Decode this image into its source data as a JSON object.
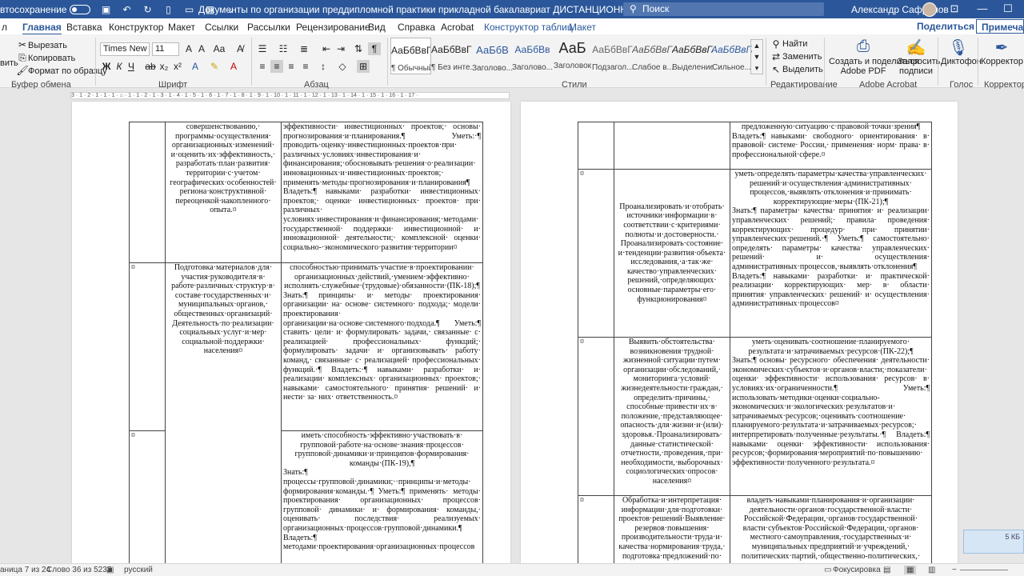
{
  "titlebar": {
    "autosave_label": "втосохранение",
    "doc_title": "Документы по организации преддипломной практики прикладной бакалавриат ДИСТАНЦИОННОЕ  -  режим совместимости  -  Word",
    "search_placeholder": "Поиск",
    "user_name": "Александр Сафронов",
    "minimize": "—",
    "restore": "☐"
  },
  "tabs": {
    "file": "л",
    "home": "Главная",
    "insert": "Вставка",
    "design": "Конструктор",
    "layout": "Макет",
    "references": "Ссылки",
    "mailings": "Рассылки",
    "review": "Рецензирование",
    "view": "Вид",
    "help": "Справка",
    "acrobat": "Acrobat",
    "table_design": "Конструктор таблиц",
    "table_layout": "Макет",
    "share": "Поделиться",
    "comments": "Примечан"
  },
  "ribbon": {
    "clipboard": {
      "cut": "Вырезать",
      "copy": "Копировать",
      "format_painter": "Формат по образцу",
      "paste": "вить",
      "label": "Буфер обмена"
    },
    "font": {
      "name": "Times New Rc",
      "size": "11",
      "label": "Шрифт"
    },
    "paragraph": {
      "label": "Абзац"
    },
    "styles": {
      "label": "Стили",
      "items": [
        {
          "preview": "АаБбВвГг,",
          "name": "¶ Обычный"
        },
        {
          "preview": "АаБбВвГг,",
          "name": "¶ Без инте..."
        },
        {
          "preview": "АаБбВ",
          "name": "Заголово..."
        },
        {
          "preview": "АаБбВв",
          "name": "Заголово..."
        },
        {
          "preview": "АаБ",
          "name": "Заголовок"
        },
        {
          "preview": "АаБбВвГ",
          "name": "Подзагол..."
        },
        {
          "preview": "АаБбВвГг",
          "name": "Слабое в..."
        },
        {
          "preview": "АаБбВвГг",
          "name": "Выделение"
        },
        {
          "preview": "АаБбВвГг",
          "name": "Сильное..."
        }
      ]
    },
    "editing": {
      "find": "Найти",
      "replace": "Заменить",
      "select": "Выделить",
      "label": "Редактирование"
    },
    "acrobat": {
      "create_share": "Создать и поделиться",
      "create_share2": "Adobe PDF",
      "request": "Запросить",
      "request2": "подписи",
      "label": "Adobe Acrobat"
    },
    "voice": {
      "dictate": "Диктофон",
      "label": "Голос"
    },
    "editor": {
      "editor": "Корректор",
      "label": "Корректор"
    }
  },
  "ruler_text": "3 · 1 · 2 · 1 · 1 · 1 · ⌂ · 1 · 1 · 2 · 1 · 3 · 1 · 4 · 1 · 5 · 1 · 6 · 1 · 7 · 1 · 8 · 1 · 9 · 1 · 10 · 1 · 11 · 1 · 12 · 1 · 13 · 1 · 14 · 1 · 15 · 1 · 16 · 1 · 17 ·",
  "left_page": {
    "rows": [
      {
        "c1": "",
        "c2": "совершенствованию,· программы·осуществления· организационных·изменений· и·оценить·их·эффективность,· разработать·план·развития· территории·с·учетом· географических·особенностей· региона·конструктивной· переоценкой·накопленного· опыта.¤",
        "c3": "эффективности· инвестиционных· проектов;· основы· прогнозирования·и·планирования.¶ Уметь:·¶ проводить·оценку·инвестиционных·проектов·при· различных·условиях·инвестирования·и· финансирования;·обосновывать·решения·о·реализации· инновационных·и·инвестиционных·проектов;· применять·методы·прогнозирования·и·планирования¶ Владеть:¶ навыками· разработки· инвестиционных· проектов;· оценки· инвестиционных· проектов· при· различных· условиях·инвестирования·и·финансирования;·методами· государственной· поддержки· инвестиционной· и· инновационной· деятельности;· комплексной· оценки· социально-·экономического·развития·территории¤"
      },
      {
        "c1": "¤",
        "c2": "Подготовка·материалов·для· участия·руководителя·в· работе·различных·структур·в· составе·государственных·и· муниципальных·органов,· общественных·организаций· Деятельность·по·реализации· социальных·услуг·и·мер· социальной·поддержки· населения¤",
        "c3_head": "способностью·принимать·участие·в·проектировании· организационных·действий,·умением·эффективно· исполнять·служебные·(трудовые)·обязанности·(ПК-18);¶",
        "c3": "Знать:¶ принципы· и· методы· проектирования· организации· на· основе· системного· подхода;· модели· проектирования· организации·на·основе·системного·подхода.¶ Уметь:¶ ставить· цели· и· формулировать· задачи,· связанные· с· реализацией· профессиональных· функций;· формулировать· задачи· и· организовывать· работу· команд,· связанные· с· реализацией· профессиональных· функций.·¶ Владеть:·¶ навыками· разработки· и· реализации· комплексных· организационных· проектов;· навыками· самостоятельного· принятия· решений· и· нести· за· них· ответственность.¤"
      },
      {
        "c1": "¤",
        "c2": "",
        "c3_head": "иметь·способность·эффективно·участвовать·в· групповой·работе·на·основе·знания·процессов· групповой·динамики·и·принципов·формирования· команды·(ПК-19),¶",
        "c3": "Знать:¶ процессы·групповой·динамики;··принципы·и·методы· формирования·команды.·¶ Уметь:¶ применять· методы· проектирования· организационных· процессов· групповой· динамики· и· формирования· команды,· оценивать· последствия· реализуемых· организационных·процессов·групповой·динамики.¶ Владеть:¶ методами·проектирования·организационных·процессов"
      }
    ]
  },
  "right_page": {
    "rows": [
      {
        "c1": "",
        "c2": "",
        "c3_head": "предложенную·ситуацию·с·правовой·точки·зрения¶",
        "c3": "Владеть:¶ навыками· свободного· ориентирования· в· правовой· системе· России,· применения· норм· права· в· профессиональной·сфере.¤"
      },
      {
        "c1": "¤",
        "c2": "Проанализировать·и·отобрать· источники·информации·в· соответствии·с·критериями· полноты·и·достоверности.· Проанализировать·состояние· и·тенденции·развития·объекта· исследования,·а·так·же· качество·управленческих· решений,·определяющих· основные·параметры·его· функционирования¤",
        "c3_head": "уметь·определять·параметры·качества·управленческих· решений·и·осуществления·административных· процессов,·выявлять·отклонения·и·принимать· корректирующие·меры·(ПК-21);¶",
        "c3": "Знать:¶ параметры· качества· принятия· и· реализации· управленческих· решений;· правила· проведения· корректирующих· процедур· при· принятии· управленческих·решений.·¶ Уметь:¶ самостоятельно· определять· параметры· качества· управленческих· решений· и· осуществления· административных·процессов,·выявлять·отклонения¶ Владеть:¶ навыками· разработки· и· практической· реализации· корректирующих· мер· в· области· принятия· управленческих· решений· и· осуществления· административных·процессов¤"
      },
      {
        "c1": "¤",
        "c2": "Выявить·обстоятельства· возникновения·трудной· жизненной·ситуации·путем· организации·обследований,· мониторинга·условий· жизнедеятельности·граждан,· определить·причины,· способные·привести·их·в· положение,·представляющее· опасность·для·жизни·и·(или)· здоровья.·Проанализировать· данные·статистической· отчетности,·проведения,·при· необходимости,·выборочных· социологических·опросов· населения¤",
        "c3_head": "уметь·оценивать·соотношение·планируемого· результата·и·затрачиваемых·ресурсов·(ПК-22);¶",
        "c3": "Знать:¶ основы· ресурсного· обеспечения· деятельности· экономических·субъектов·и·органов·власти;·показатели· оценки· эффективности· использования· ресурсов· в· условиях·их·ограниченности.¶ Уметь:¶ использовать·методики·оценки·социально- экономических·и·экологических·результатов·и· затрачиваемых·ресурсов;·оценивать·соотношение· планируемого·результата·и·затрачиваемых·ресурсов;· интерпретировать·полученные·результаты.·¶ Владеть:¶ навыками· оценки· эффективности· использования· ресурсов;·формирования·мероприятий·по·повышению· эффективности·полученного·результата.¤"
      },
      {
        "c1": "¤",
        "c2": "Обработка·и·интерпретация· информации·для·подготовки· проектов·решений·Выявление· резервов·повышения· производительности·труда·и· качества·нормирования·труда,· подготовка·предложений·по·",
        "c3_head": "владеть·навыками·планирования·и·организации· деятельности·органов·государственной·власти· Российской·Федерации,·органов·государственной· власти·субъектов·Российской·Федерации,·органов· местного·самоуправления,·государственных·и· муниципальных·предприятий·и·учреждений,· политических·партий,·общественно-политических,·",
        "c3": ""
      }
    ]
  },
  "statusbar": {
    "page": "аница 7 из 24",
    "words": "Слово 36 из 5232",
    "lang": "русский",
    "focus": "Фокусировка"
  },
  "notification": {
    "text": "5 КБ"
  }
}
